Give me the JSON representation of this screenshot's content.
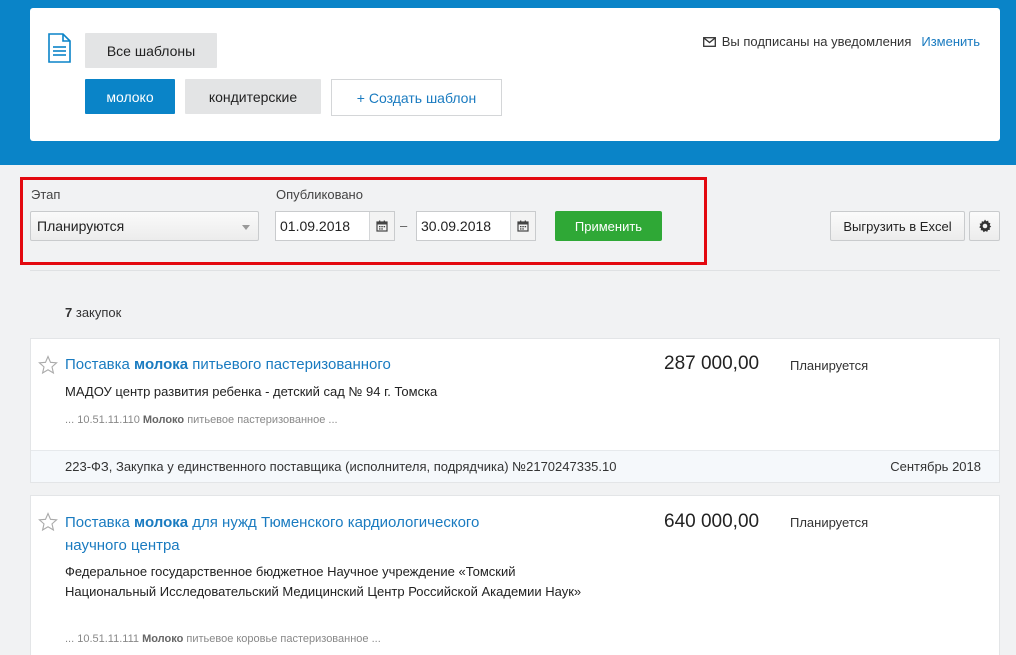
{
  "templates": {
    "all_label": "Все шаблоны",
    "tags": [
      "молоко",
      "кондитерские"
    ],
    "create_label": "+ Создать шаблон",
    "subscription_text": "Вы подписаны на уведомления",
    "change_label": "Изменить"
  },
  "filters": {
    "stage_label": "Этап",
    "stage_value": "Планируются",
    "published_label": "Опубликовано",
    "date_from": "01.09.2018",
    "date_separator": "–",
    "date_to": "30.09.2018",
    "apply_label": "Применить",
    "export_label": "Выгрузить в Excel"
  },
  "results": {
    "count_number": "7",
    "count_text": "закупок"
  },
  "purchases": [
    {
      "title_pre": "Поставка ",
      "title_bold": "молока",
      "title_post": " питьевого пастеризованного",
      "price": "287 000,00",
      "status": "Планируется",
      "org": "МАДОУ центр развития ребенка - детский сад № 94 г. Томска",
      "okpd_code": "... 10.51.11.110 ",
      "okpd_bold": "Молоко",
      "okpd_rest": " питьевое пастеризованное ...",
      "law_info": "223-ФЗ, Закупка у единственного поставщика (исполнителя, подрядчика) №2170247335.10",
      "month": "Сентябрь 2018"
    },
    {
      "title_pre": "Поставка ",
      "title_bold": "молока",
      "title_post": " для нужд Тюменского кардиологического научного центра",
      "price": "640 000,00",
      "status": "Планируется",
      "org": "Федеральное государственное бюджетное Научное учреждение «Томский Национальный Исследовательский Медицинский Центр Российской Академии Наук»",
      "okpd_code": "... 10.51.11.111 ",
      "okpd_bold": "Молоко",
      "okpd_rest": " питьевое коровье пастеризованное ..."
    }
  ],
  "colors": {
    "brand_blue": "#0a84c8",
    "apply_green": "#2fa836",
    "highlight_red": "#e3080f"
  }
}
